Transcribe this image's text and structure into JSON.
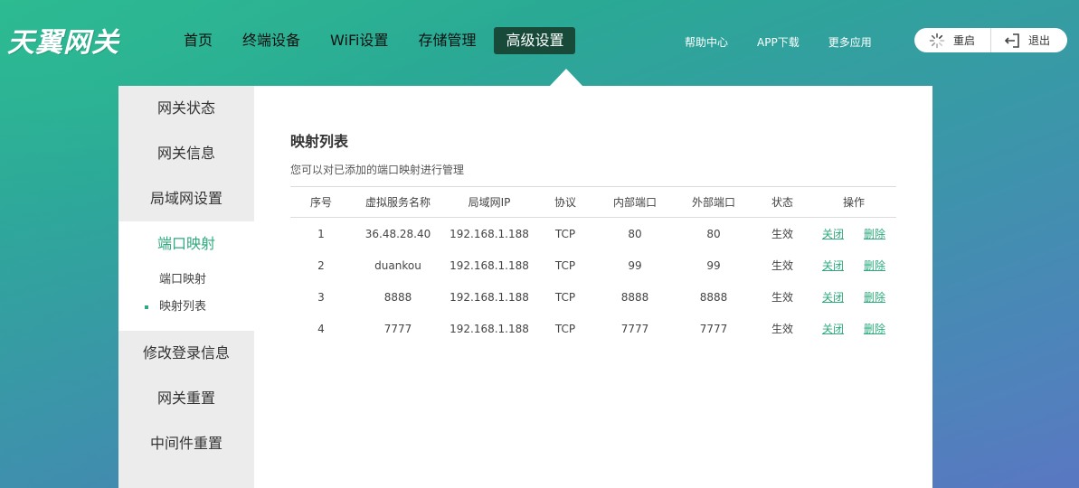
{
  "brand": {
    "logo_text": "天翼网关"
  },
  "nav": {
    "items": [
      {
        "label": "首页"
      },
      {
        "label": "终端设备"
      },
      {
        "label": "WiFi设置"
      },
      {
        "label": "存储管理"
      },
      {
        "label": "高级设置",
        "active": true
      }
    ]
  },
  "top_links": {
    "help": "帮助中心",
    "app": "APP下载",
    "more": "更多应用"
  },
  "actions": {
    "restart": "重启",
    "logout": "退出"
  },
  "sidebar": {
    "items": [
      {
        "label": "网关状态"
      },
      {
        "label": "网关信息"
      },
      {
        "label": "局域网设置"
      }
    ],
    "active_group": {
      "label": "端口映射",
      "subitems": [
        {
          "label": "端口映射"
        },
        {
          "label": "映射列表",
          "selected": true
        }
      ]
    },
    "items_after": [
      {
        "label": "修改登录信息"
      },
      {
        "label": "网关重置"
      },
      {
        "label": "中间件重置"
      }
    ]
  },
  "main": {
    "title": "映射列表",
    "description": "您可以对已添加的端口映射进行管理",
    "table": {
      "headers": [
        "序号",
        "虚拟服务名称",
        "局域网IP",
        "协议",
        "内部端口",
        "外部端口",
        "状态",
        "操作"
      ],
      "rows": [
        {
          "no": "1",
          "name": "36.48.28.40",
          "ip": "192.168.1.188",
          "protocol": "TCP",
          "internal": "80",
          "external": "80",
          "status": "生效",
          "close": "关闭",
          "delete": "删除"
        },
        {
          "no": "2",
          "name": "duankou",
          "ip": "192.168.1.188",
          "protocol": "TCP",
          "internal": "99",
          "external": "99",
          "status": "生效",
          "close": "关闭",
          "delete": "删除"
        },
        {
          "no": "3",
          "name": "8888",
          "ip": "192.168.1.188",
          "protocol": "TCP",
          "internal": "8888",
          "external": "8888",
          "status": "生效",
          "close": "关闭",
          "delete": "删除"
        },
        {
          "no": "4",
          "name": "7777",
          "ip": "192.168.1.188",
          "protocol": "TCP",
          "internal": "7777",
          "external": "7777",
          "status": "生效",
          "close": "关闭",
          "delete": "删除"
        }
      ]
    }
  },
  "colors": {
    "accent": "#2eaa7d",
    "nav_active_bg": "#174a38",
    "sidebar_bg": "#ececec"
  },
  "icons": {
    "restart": "loading-spinner-icon",
    "logout": "logout-arrow-icon"
  }
}
